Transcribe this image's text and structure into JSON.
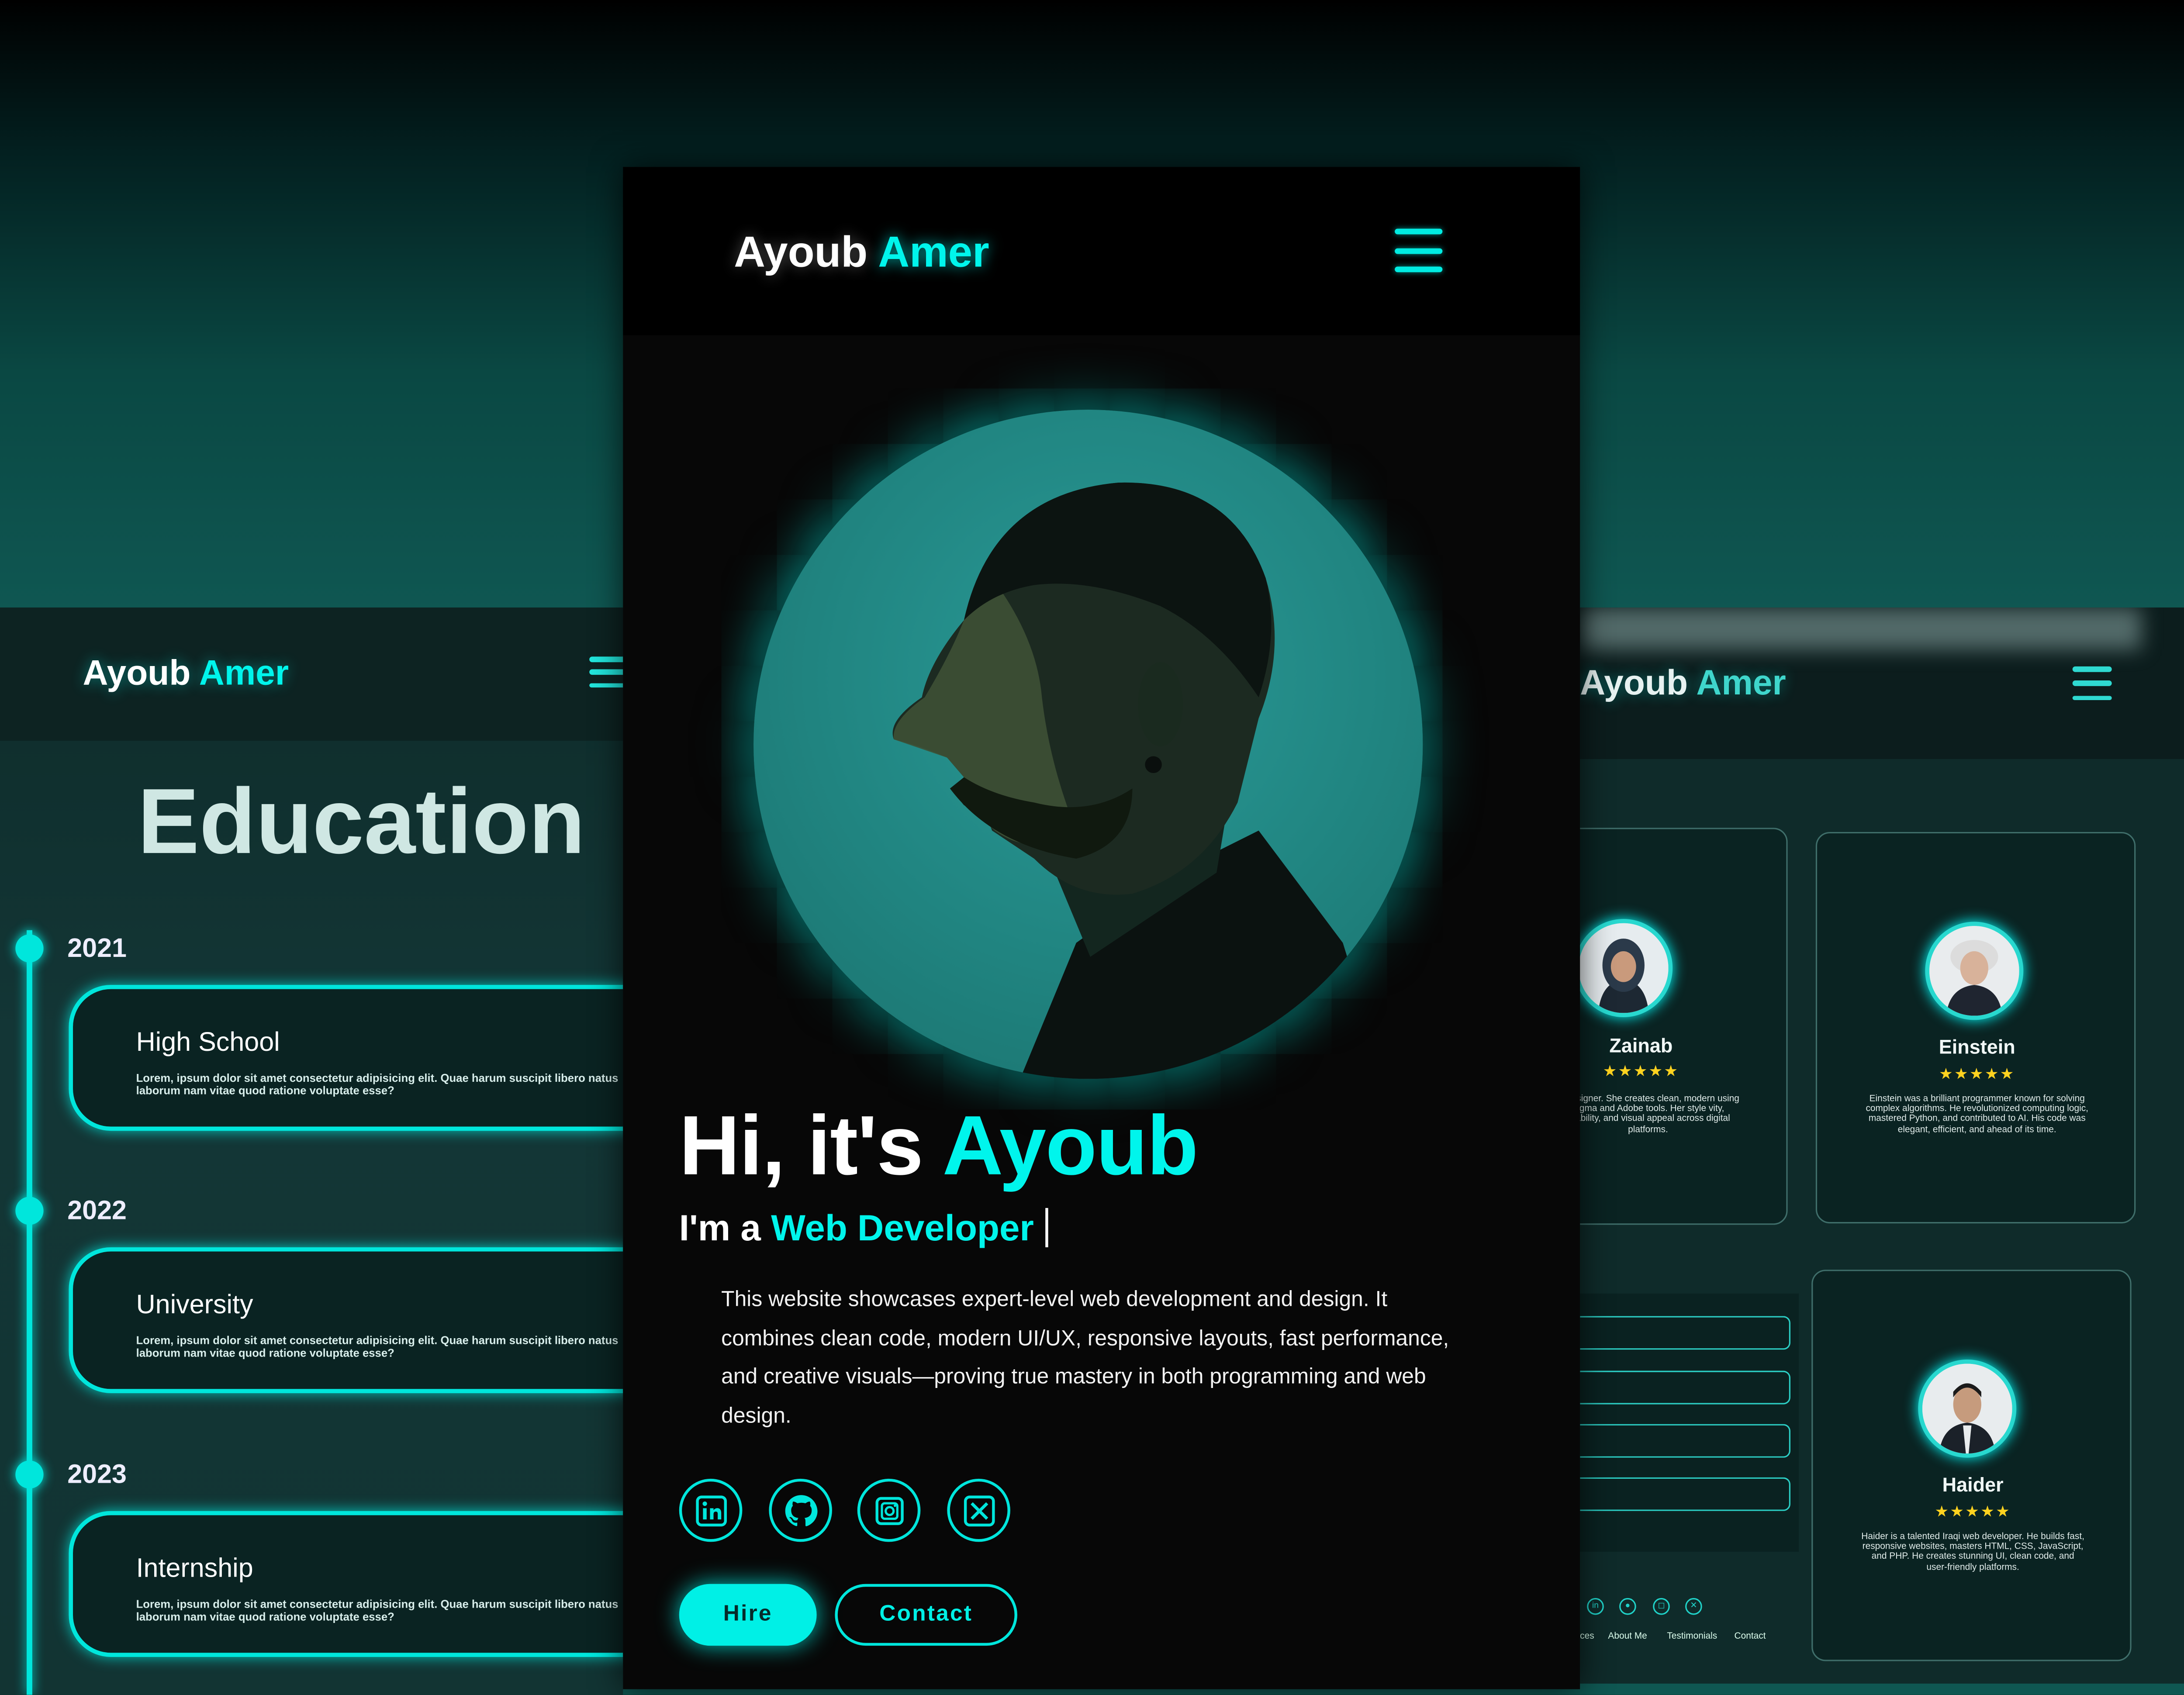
{
  "colors": {
    "accent": "#00f5ec",
    "page_teal": "#0f5752",
    "panel_dark": "#070707",
    "star": "#ffd21f"
  },
  "left_panel": {
    "logo_first": "Ayoub",
    "logo_second": "Amer",
    "menu_icon": "hamburger-icon",
    "section_title": "Education",
    "timeline": [
      {
        "year": "2021",
        "title": "High School",
        "text": "Lorem, ipsum dolor sit amet consectetur adipisicing elit. Quae harum suscipit libero natus laborum nam vitae quod ratione voluptate esse?"
      },
      {
        "year": "2022",
        "title": "University",
        "text": "Lorem, ipsum dolor sit amet consectetur adipisicing elit. Quae harum suscipit libero natus laborum nam vitae quod ratione voluptate esse?"
      },
      {
        "year": "2023",
        "title": "Internship",
        "text": "Lorem, ipsum dolor sit amet consectetur adipisicing elit. Quae harum suscipit libero natus laborum nam vitae quod ratione voluptate esse?"
      }
    ]
  },
  "center_panel": {
    "logo_first": "Ayoub",
    "logo_second": "Amer",
    "menu_icon": "hamburger-icon",
    "greeting_prefix": "Hi, it's",
    "greeting_name": "Ayoub",
    "role_prefix": "I'm a",
    "role_value": "Web Developer",
    "description": "This website showcases expert-level web development and design. It combines clean code, modern UI/UX, responsive layouts, fast performance, and creative visuals—proving true mastery in both programming and web design.",
    "social": [
      "linkedin-icon",
      "github-icon",
      "instagram-icon",
      "x-icon"
    ],
    "hire_label": "Hire",
    "contact_label": "Contact"
  },
  "right_panel": {
    "logo_first": "Ayoub",
    "logo_second": "Amer",
    "menu_icon": "hamburger-icon",
    "stars": "★★★★★",
    "testimonials": [
      {
        "name": "Zainab",
        "text": "gi designer. She creates clean, modern using Figma and Adobe tools. Her style vity, usability, and visual appeal across digital platforms."
      },
      {
        "name": "Einstein",
        "text": "Einstein was a brilliant programmer known for solving complex algorithms. He revolutionized computing logic, mastered Python, and contributed to AI. His code was elegant, efficient, and ahead of its time."
      },
      {
        "name": "Haider",
        "text": "Haider is a talented Iraqi web developer. He builds fast, responsive websites, masters HTML, CSS, JavaScript, and PHP. He creates stunning UI, clean code, and user-friendly platforms."
      }
    ],
    "footer_links": [
      "ces",
      "About Me",
      "Testimonials",
      "Contact"
    ]
  }
}
